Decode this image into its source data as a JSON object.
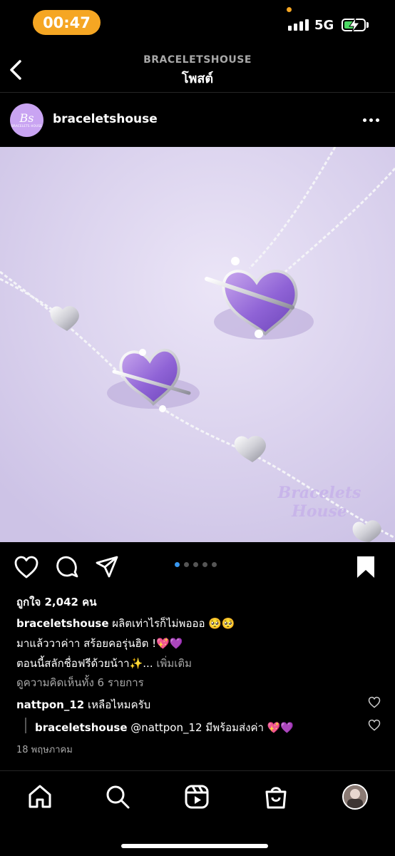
{
  "status_bar": {
    "time": "00:47",
    "network": "5G"
  },
  "header": {
    "account": "BRACELETSHOUSE",
    "title": "โพสต์"
  },
  "post": {
    "username": "braceletshouse",
    "avatar_logo": "Bs",
    "avatar_text": "BRACELETS HOUSE",
    "watermark_line1": "Bracelets",
    "watermark_line2": "House",
    "carousel": {
      "count": 5,
      "active": 1
    },
    "likes": "ถูกใจ 2,042 คน",
    "caption": {
      "username": "braceletshouse",
      "line1": "ผลิตเท่าไรก็ไม่พอออ 🥺🥺",
      "line2": "มาแล้ววาค่าา สร้อยคอรุ่นฮิต !💖💜",
      "line3": "ตอนนี้สลักชื่อฟรีด้วยน้าา✨...",
      "more_label": "เพิ่มเติม"
    },
    "view_comments": "ดูความคิดเห็นทั้ง 6 รายการ",
    "comments": [
      {
        "username": "nattpon_12",
        "text": "เหลือไหมครับ"
      },
      {
        "username": "braceletshouse",
        "text": "@nattpon_12 มีพร้อมส่งค่า 💖💜"
      }
    ],
    "date": "18 พฤษภาคม"
  },
  "colors": {
    "accent_blue": "#3897f0",
    "time_pill": "#f5a623",
    "battery": "#4cd964",
    "image_bg": "#ddd6ef"
  },
  "icons": {
    "back": "chevron-left-icon",
    "more": "more-icon",
    "like": "heart-icon",
    "comment": "comment-icon",
    "share": "paper-plane-icon",
    "save": "bookmark-icon",
    "home": "home-icon",
    "search": "search-icon",
    "reels": "reels-icon",
    "shop": "shop-icon"
  }
}
